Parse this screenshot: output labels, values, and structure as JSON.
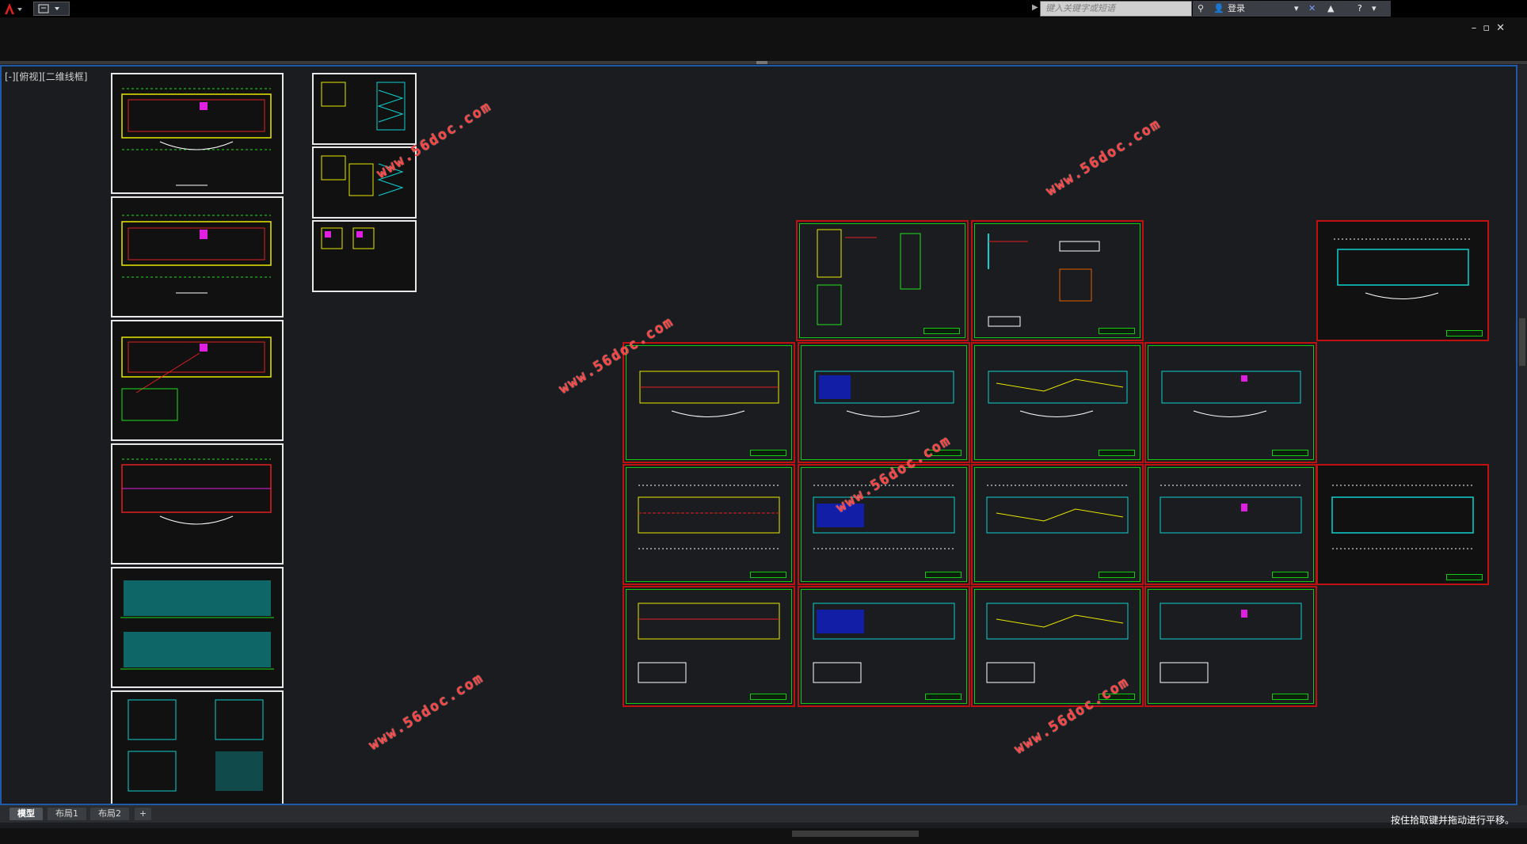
{
  "titlebar": {
    "search_placeholder": "键入关键字或短语",
    "login_label": "登录"
  },
  "viewport": {
    "label": "[-][俯视][二维线框]",
    "watermarks": [
      "www.56doc.com",
      "www.56doc.com",
      "www.56doc.com",
      "www.56doc.com",
      "www.56doc.com",
      "www.56doc.com"
    ]
  },
  "layout_tabs": [
    "模型",
    "布局1",
    "布局2"
  ],
  "add_tab_label": "+",
  "status": {
    "message": "按住拾取键并拖动进行平移。"
  },
  "colors": {
    "viewport_border": "#1e5aa8",
    "sheet_frame_red": "#c01010",
    "sheet_frame_green": "#14c814",
    "watermark": "#ff4040"
  }
}
